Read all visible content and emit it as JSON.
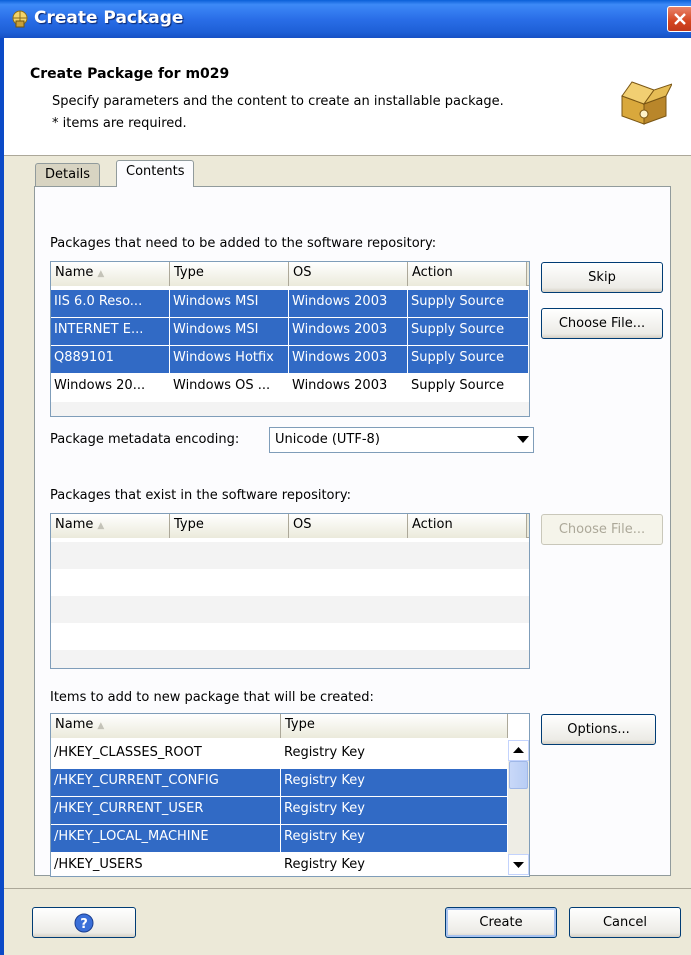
{
  "window": {
    "title": "Create Package"
  },
  "header": {
    "title": "Create Package for m029",
    "description": "Specify parameters and the content to create an installable package.",
    "required_note": "* items are required."
  },
  "tabs": [
    {
      "label": "Details"
    },
    {
      "label": "Contents"
    }
  ],
  "add_section": {
    "label": "Packages that need to be added to the software repository:",
    "columns": [
      "Name",
      "Type",
      "OS",
      "Action"
    ],
    "rows": [
      {
        "name": "IIS 6.0 Reso...",
        "type": "Windows MSI",
        "os": "Windows 2003",
        "action": "Supply Source",
        "selected": true
      },
      {
        "name": "INTERNET E...",
        "type": "Windows MSI",
        "os": "Windows 2003",
        "action": "Supply Source",
        "selected": true
      },
      {
        "name": "Q889101",
        "type": "Windows Hotfix",
        "os": "Windows 2003",
        "action": "Supply Source",
        "selected": true
      },
      {
        "name": "Windows 20...",
        "type": "Windows OS ...",
        "os": "Windows 2003",
        "action": "Supply Source",
        "selected": false
      }
    ],
    "skip_label": "Skip",
    "choose_file_label": "Choose File..."
  },
  "encoding": {
    "label": "Package metadata encoding:",
    "value": "Unicode (UTF-8)"
  },
  "exist_section": {
    "label": "Packages that exist in the software repository:",
    "columns": [
      "Name",
      "Type",
      "OS",
      "Action"
    ],
    "choose_file_label": "Choose File..."
  },
  "items_section": {
    "label": "Items to add to new package that will be created:",
    "columns": [
      "Name",
      "Type"
    ],
    "rows": [
      {
        "name": "/HKEY_CLASSES_ROOT",
        "type": "Registry Key",
        "selected": false
      },
      {
        "name": "/HKEY_CURRENT_CONFIG",
        "type": "Registry Key",
        "selected": true
      },
      {
        "name": "/HKEY_CURRENT_USER",
        "type": "Registry Key",
        "selected": true
      },
      {
        "name": "/HKEY_LOCAL_MACHINE",
        "type": "Registry Key",
        "selected": true
      },
      {
        "name": "/HKEY_USERS",
        "type": "Registry Key",
        "selected": false
      }
    ],
    "options_label": "Options..."
  },
  "footer": {
    "create_label": "Create",
    "cancel_label": "Cancel"
  },
  "colors": {
    "selection": "#316ac5",
    "titlebar": "#2a6ee8"
  },
  "icons": [
    "package-globe-icon",
    "close-icon",
    "open-box-icon",
    "help-icon",
    "chevron-down-icon",
    "scroll-up-icon",
    "scroll-down-icon",
    "sort-icon"
  ]
}
